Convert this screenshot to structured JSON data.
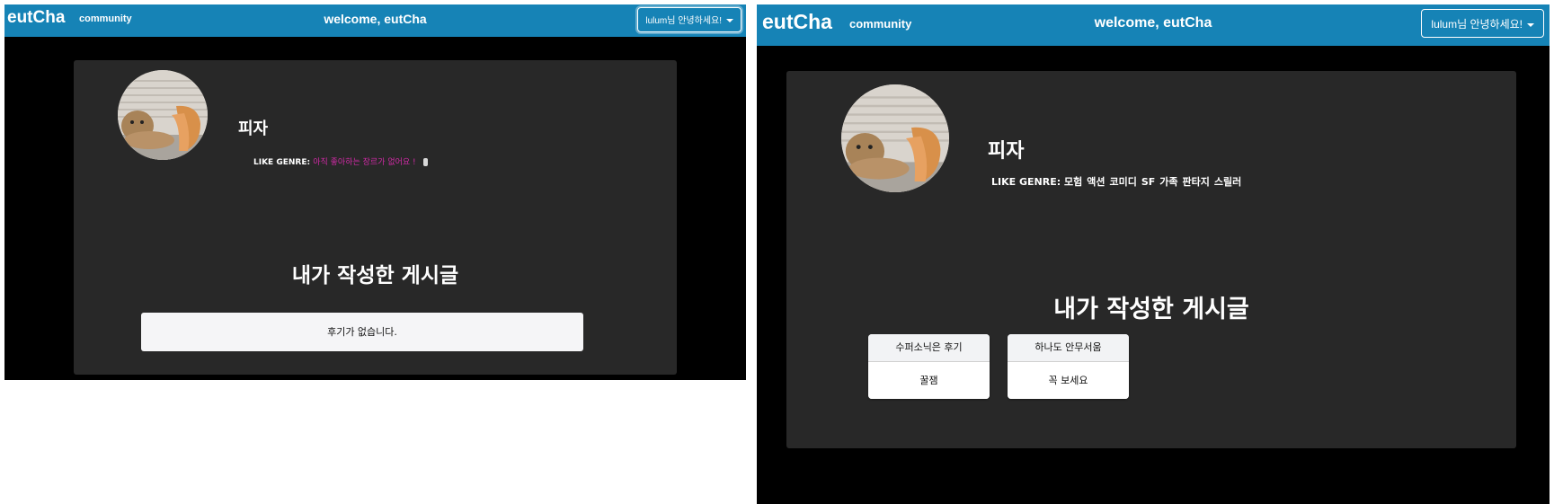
{
  "left": {
    "navbar": {
      "brand": "eutCha",
      "community": "community",
      "welcome": "welcome, eutCha",
      "user_menu": "lulum님 안녕하세요!"
    },
    "profile": {
      "nickname": "피자",
      "like_genre_label": "LIKE GENRE:",
      "like_genre_empty": "아직 좋아하는 장르가 없어요 !"
    },
    "posts": {
      "title": "내가 작성한 게시글",
      "empty_message": "후기가 없습니다."
    }
  },
  "right": {
    "navbar": {
      "brand": "eutCha",
      "community": "community",
      "welcome": "welcome, eutCha",
      "user_menu": "lulum님 안녕하세요!"
    },
    "profile": {
      "nickname": "피자",
      "like_genre_label": "LIKE GENRE:",
      "genres": [
        "모험",
        "액션",
        "코미디",
        "SF",
        "가족",
        "판타지",
        "스릴러"
      ]
    },
    "posts": {
      "title": "내가 작성한 게시글",
      "cards": [
        {
          "title": "수퍼소닉은 후기",
          "body": "꿀잼"
        },
        {
          "title": "하나도 안무서움",
          "body": "꼭 보세요"
        }
      ]
    }
  },
  "colors": {
    "navbar": "#1683b6",
    "panel": "#282828",
    "background": "#000000",
    "genre_empty": "#d12aa6"
  }
}
